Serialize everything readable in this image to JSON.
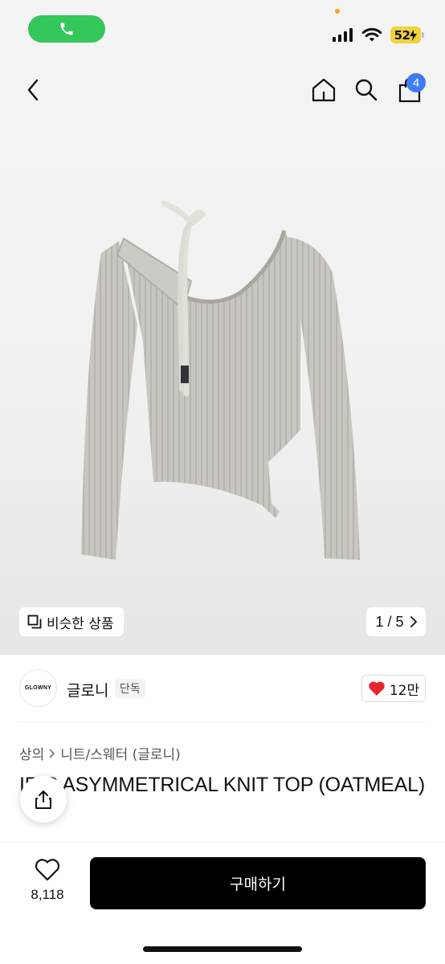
{
  "status_bar": {
    "battery": "52",
    "icons": [
      "phone-icon",
      "signal-icon",
      "wifi-icon",
      "battery-icon"
    ],
    "call_color": "#34c759",
    "battery_color": "#f2d23c"
  },
  "nav": {
    "cart_count": "4",
    "icons": [
      "back-icon",
      "home-icon",
      "search-icon",
      "shopping-bag-icon"
    ],
    "badge_color": "#3d7cf5"
  },
  "gallery": {
    "similar_label": "비슷한 상품",
    "pager": "1 / 5"
  },
  "brand": {
    "logo_text": "GLOWNY",
    "name": "글로니",
    "tag": "단독",
    "likes": "12만"
  },
  "breadcrumb": {
    "category": "상의",
    "subcategory": "니트/스웨터 (글로니)"
  },
  "product": {
    "title": "IRIS ASYMMETRICAL KNIT TOP (OATMEAL)"
  },
  "bottom": {
    "wish_count": "8,118",
    "buy_label": "구매하기"
  },
  "colors": {
    "heart": "#e8262f",
    "primary_button": "#000000"
  }
}
